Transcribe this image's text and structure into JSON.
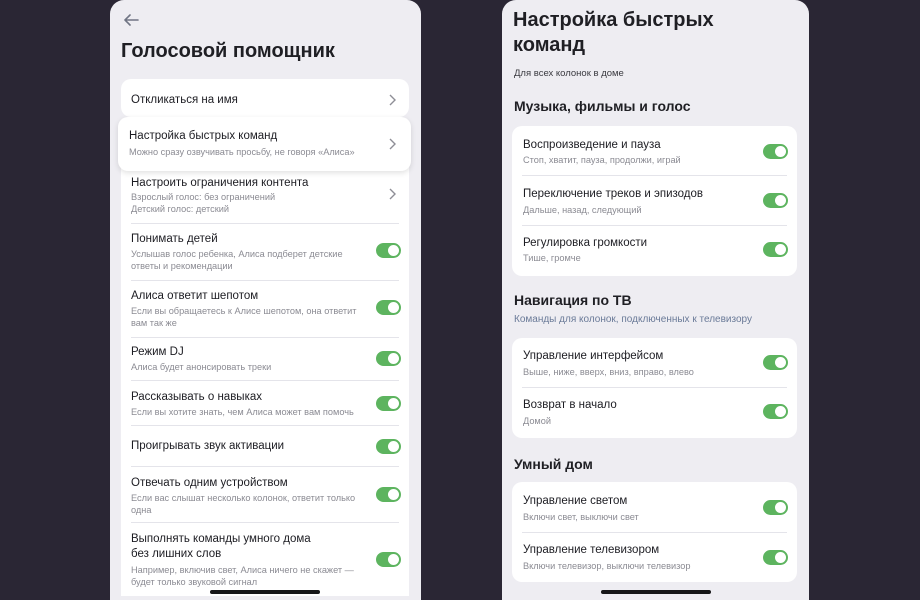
{
  "left": {
    "title": "Голосовой помощник",
    "items": [
      {
        "title": "Откликаться на имя"
      },
      {
        "title": "Настройка быстрых команд",
        "sub": "Можно сразу озвучивать просьбу, не говоря «Алиса»"
      },
      {
        "title": "Настроить ограничения контента",
        "sub": "Взрослый голос: без ограничений",
        "sub2": "Детский голос: детский"
      },
      {
        "title": "Понимать детей",
        "sub": "Услышав голос ребенка, Алиса подберет детские",
        "sub2": "ответы и рекомендации"
      },
      {
        "title": "Алиса ответит шепотом",
        "sub": "Если вы обращаетесь к Алисе шепотом, она ответит",
        "sub2": "вам так же"
      },
      {
        "title": "Режим DJ",
        "sub": "Алиса будет анонсировать треки"
      },
      {
        "title": "Рассказывать о навыках",
        "sub": "Если вы хотите знать, чем Алиса может вам помочь"
      },
      {
        "title": "Проигрывать звук активации"
      },
      {
        "title": "Отвечать одним устройством",
        "sub": "Если вас слышат несколько колонок, ответит только",
        "sub2": "одна"
      },
      {
        "title": "Выполнять команды умного дома",
        "title2": "без лишних слов",
        "sub": "Например, включив свет, Алиса ничего не скажет —",
        "sub2": "будет только звуковой сигнал"
      }
    ]
  },
  "right": {
    "title": "Настройка быстрых команд",
    "subtitle": "Для всех колонок в доме",
    "sections": [
      {
        "title": "Музыка, фильмы и голос",
        "items": [
          {
            "title": "Воспроизведение и пауза",
            "sub": "Стоп, хватит, пауза, продолжи, играй"
          },
          {
            "title": "Переключение треков и эпизодов",
            "sub": "Дальше, назад, следующий"
          },
          {
            "title": "Регулировка громкости",
            "sub": "Тише, громче"
          }
        ]
      },
      {
        "title": "Навигация по ТВ",
        "subtitle": "Команды для колонок, подключенных к телевизору",
        "items": [
          {
            "title": "Управление интерфейсом",
            "sub": "Выше, ниже, вверх, вниз, вправо, влево"
          },
          {
            "title": "Возврат в начало",
            "sub": "Домой"
          }
        ]
      },
      {
        "title": "Умный дом",
        "items": [
          {
            "title": "Управление светом",
            "sub": "Включи свет, выключи свет"
          },
          {
            "title": "Управление телевизором",
            "sub": "Включи телевизор, выключи телевизор"
          }
        ]
      }
    ]
  },
  "colors": {
    "toggle_on": "#5db45f",
    "background": "#2a2634",
    "screen": "#eeedf2"
  },
  "icons": {
    "back": "arrow-left-icon",
    "chevron": "chevron-right-icon"
  }
}
